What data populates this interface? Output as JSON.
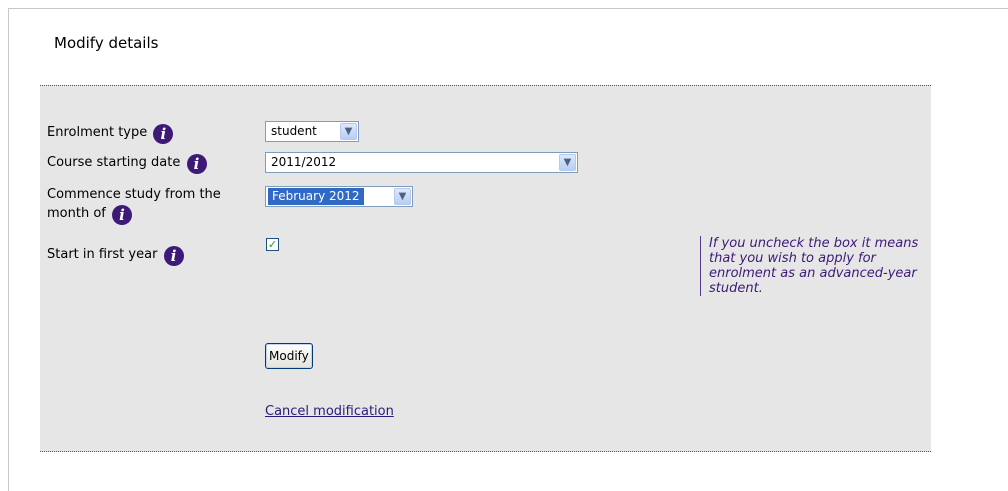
{
  "page": {
    "title": "Modify details"
  },
  "form": {
    "enrolment_type": {
      "label": "Enrolment type",
      "value": "student"
    },
    "course_start": {
      "label": "Course starting date",
      "value": "2011/2012"
    },
    "commence": {
      "label_line1": "Commence study from the",
      "label_line2": "month of",
      "value": "February 2012"
    },
    "first_year": {
      "label": "Start in first year",
      "checked": true
    },
    "hint": "If you uncheck the box it means that you wish to apply for enrolment as an advanced-year student.",
    "modify_label": "Modify",
    "cancel_label": "Cancel modification"
  },
  "icons": {
    "info": "info-icon",
    "checkmark": "check-icon",
    "dropdown": "chevron-down-icon"
  },
  "colors": {
    "accent": "#3d1a78",
    "panel_bg": "#e6e6e6",
    "selection": "#316ac5"
  }
}
